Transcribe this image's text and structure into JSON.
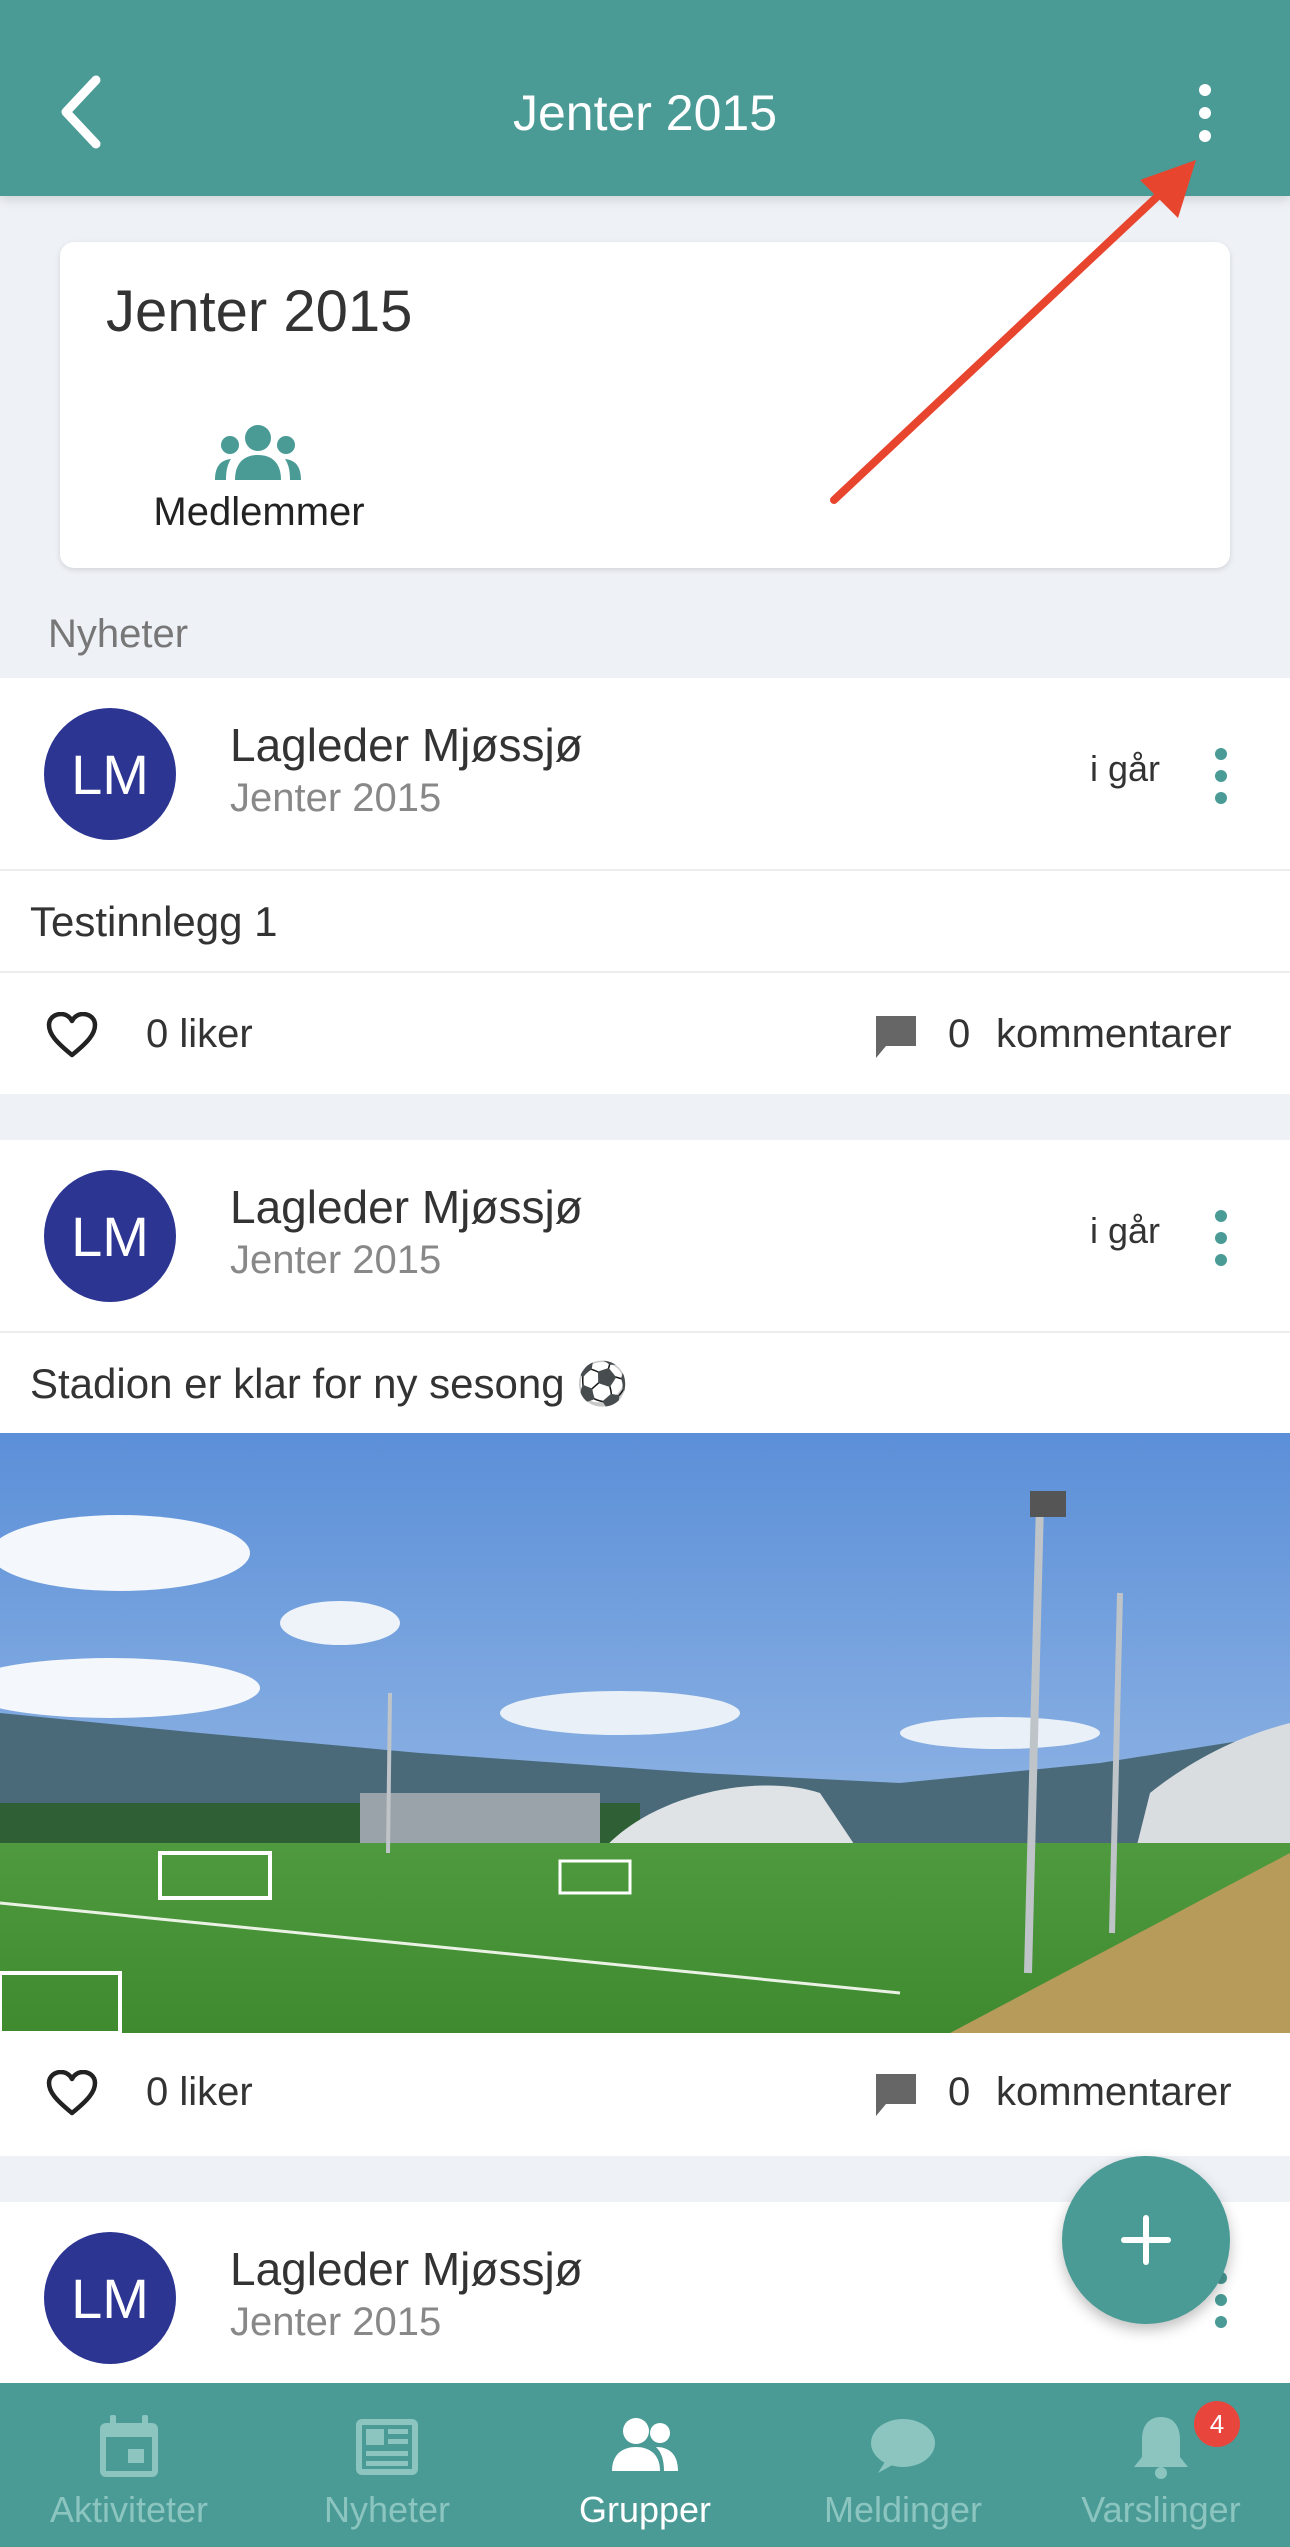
{
  "header": {
    "title": "Jenter 2015"
  },
  "group_card": {
    "name": "Jenter 2015",
    "members_label": "Medlemmer"
  },
  "news_section": {
    "label": "Nyheter"
  },
  "posts": [
    {
      "avatar_initials": "LM",
      "author": "Lagleder Mjøssjø",
      "group": "Jenter 2015",
      "time": "i går",
      "text": "Testinnlegg 1",
      "likes": "0 liker",
      "comment_count": "0",
      "comments_label": "kommentarer"
    },
    {
      "avatar_initials": "LM",
      "author": "Lagleder Mjøssjø",
      "group": "Jenter 2015",
      "time": "i går",
      "text": "Stadion er klar for ny sesong ⚽",
      "likes": "0 liker",
      "comment_count": "0",
      "comments_label": "kommentarer"
    },
    {
      "avatar_initials": "LM",
      "author": "Lagleder Mjøssjø",
      "group": "Jenter 2015"
    }
  ],
  "fab": {
    "icon": "plus-icon"
  },
  "bottom_nav": [
    {
      "label": "Aktiviteter",
      "icon": "calendar-icon"
    },
    {
      "label": "Nyheter",
      "icon": "newspaper-icon"
    },
    {
      "label": "Grupper",
      "icon": "group-icon",
      "active": true
    },
    {
      "label": "Meldinger",
      "icon": "chat-icon"
    },
    {
      "label": "Varslinger",
      "icon": "bell-icon",
      "badge": "4"
    }
  ],
  "colors": {
    "primary": "#4a9b96",
    "avatar": "#2c3592",
    "badge": "#e8453c",
    "annotation": "#e8452f"
  }
}
